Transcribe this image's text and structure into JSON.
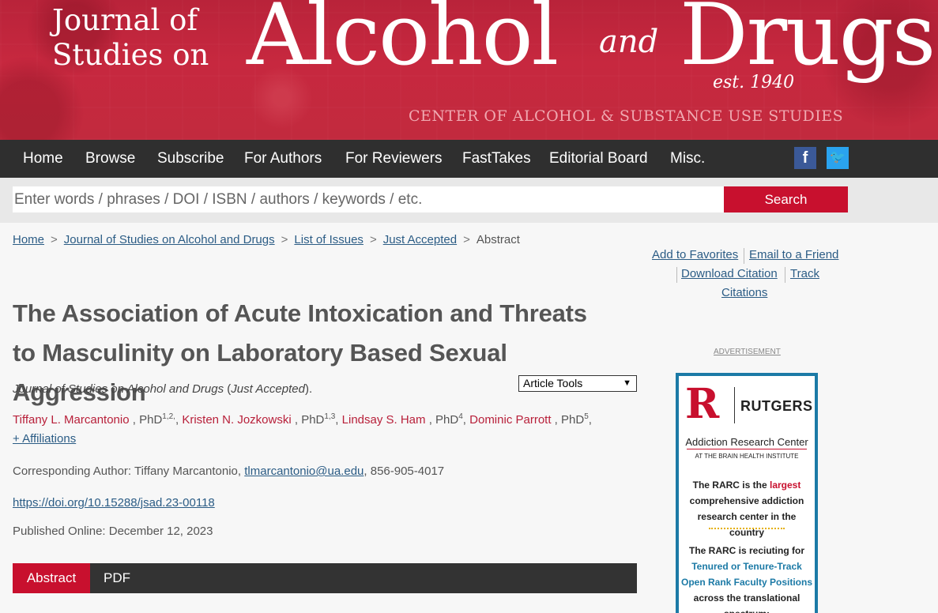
{
  "banner": {
    "journal_of": "Journal of",
    "studies_on": "Studies on",
    "alcohol": "Alcohol",
    "and": "and",
    "drugs": "Drugs",
    "est": "est. 1940",
    "center": "CENTER OF ALCOHOL & SUBSTANCE USE STUDIES"
  },
  "nav": {
    "items": [
      "Home",
      "Browse",
      "Subscribe",
      "For Authors",
      "For Reviewers",
      "FastTakes",
      "Editorial Board",
      "Misc."
    ],
    "facebook_glyph": "f",
    "twitter_glyph": "🐦"
  },
  "search": {
    "placeholder": "Enter words / phrases / DOI / ISBN / authors / keywords / etc.",
    "button_label": "Search"
  },
  "breadcrumb": {
    "items": [
      "Home",
      "Journal of Studies on Alcohol and Drugs",
      "List of Issues",
      "Just Accepted"
    ],
    "current": "Abstract",
    "separator": ">"
  },
  "tools_links": {
    "add_favorites": "Add to Favorites",
    "email_friend": "Email to a Friend",
    "download_citation": "Download Citation",
    "track": "Track",
    "citations": "Citations"
  },
  "article": {
    "title": "The Association of Acute Intoxication and Threats to Masculinity on Laboratory Based Sexual Aggression",
    "journal_name": "Journal of Studies on Alcohol and Drugs",
    "status": "Just Accepted",
    "article_tools_label": "Article Tools",
    "authors": [
      {
        "name": "Tiffany L. Marcantonio",
        "degree": "PhD",
        "sup": "1,2,"
      },
      {
        "name": "Kristen N. Jozkowski",
        "degree": "PhD",
        "sup": "1,3"
      },
      {
        "name": "Lindsay S. Ham",
        "degree": "PhD",
        "sup": "4"
      },
      {
        "name": "Dominic Parrott",
        "degree": "PhD",
        "sup": "5"
      }
    ],
    "affiliations_link": "+ Affiliations",
    "corresponding_label": "Corresponding Author: Tiffany Marcantonio,",
    "corresponding_email": "tlmarcantonio@ua.edu",
    "corresponding_phone": ", 856-905-4017",
    "doi": "https://doi.org/10.15288/jsad.23-00118",
    "published": "Published Online: December 12, 2023"
  },
  "tabs": {
    "abstract": "Abstract",
    "pdf": "PDF"
  },
  "ad": {
    "label": "ADVERTISEMENT",
    "r_letter": "R",
    "rutgers": "RUTGERS",
    "center_name": "Addiction Research Center",
    "institute": "AT THE BRAIN HEALTH INSTITUTE",
    "p1_a": "The RARC is the",
    "p1_red": "largest",
    "p1_b": "comprehensive addiction research center in the country",
    "p2_a": "The RARC is reciuting for",
    "p2_blue": "Tenured or Tenure-Track Open Rank Faculty Positions",
    "p2_b": "across the translational spectrum:"
  },
  "colors": {
    "brand_red": "#c8102e",
    "nav_bg": "#2f2f2f",
    "link_blue": "#2b5c85",
    "author_red": "#b8203a"
  }
}
